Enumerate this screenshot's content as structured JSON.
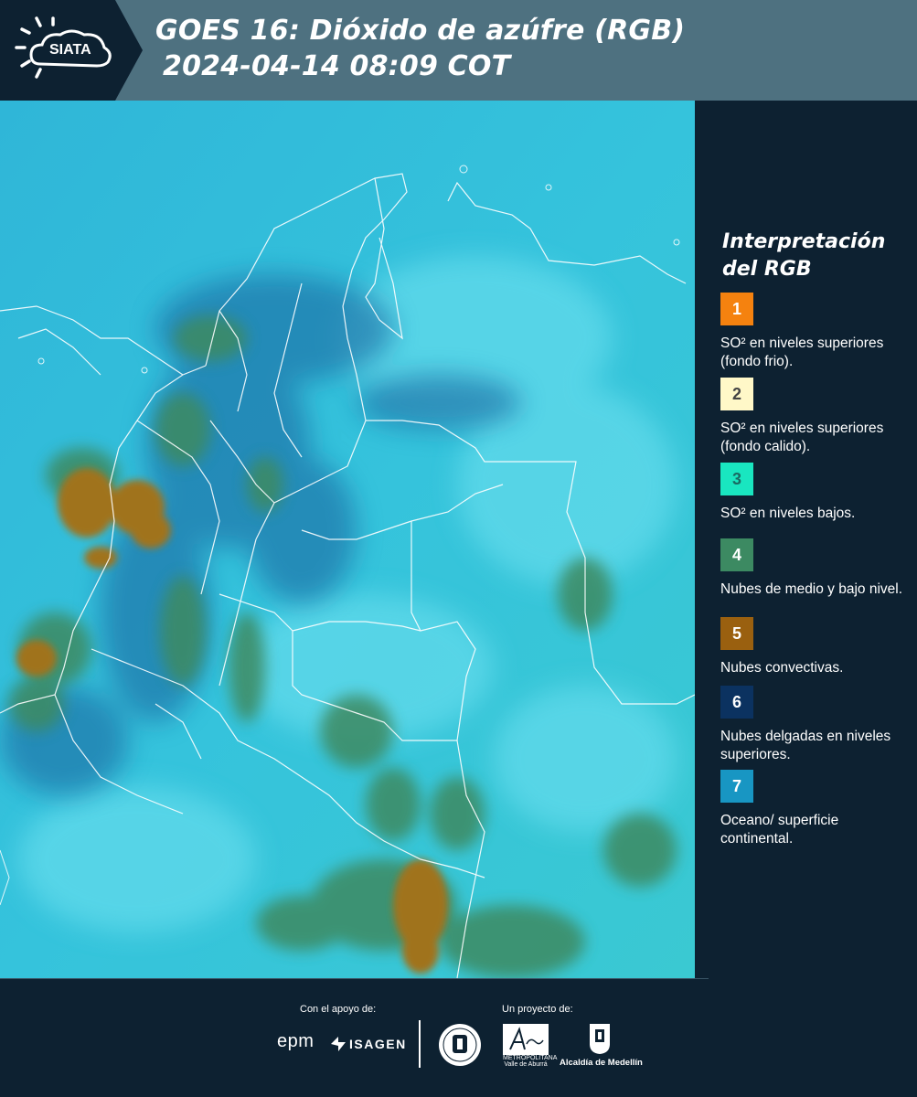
{
  "header": {
    "logo_text": "SIATA",
    "title_line1": "GOES 16: Dióxido de azúfre (RGB)",
    "title_line2": "2024-04-14 08:09 COT"
  },
  "legend": {
    "title": "Interpretación del RGB",
    "items": [
      {
        "number": "1",
        "color": "#f5820f",
        "text_color": "#ffffff",
        "label": "SO² en niveles superiores (fondo frio)."
      },
      {
        "number": "2",
        "color": "#fff8c8",
        "text_color": "#444444",
        "label": "SO² en niveles superiores (fondo calido)."
      },
      {
        "number": "3",
        "color": "#19e6c0",
        "text_color": "#1a6a62",
        "label": "SO² en niveles bajos."
      },
      {
        "number": "4",
        "color": "#3c8a62",
        "text_color": "#ffffff",
        "label": "Nubes de medio y bajo nivel."
      },
      {
        "number": "5",
        "color": "#9a600f",
        "text_color": "#ffffff",
        "label": "Nubes convectivas."
      },
      {
        "number": "6",
        "color": "#0b3260",
        "text_color": "#ffffff",
        "label": "Nubes delgadas en niveles superiores."
      },
      {
        "number": "7",
        "color": "#1896c3",
        "text_color": "#ffffff",
        "label": "Oceano/ superficie continental."
      }
    ]
  },
  "footer": {
    "support_label": "Con el apoyo de:",
    "project_label": "Un proyecto de:",
    "epm": "epm",
    "isagen": "ISAGEN",
    "area_text": "METROPOLITANA Valle de Aburrá",
    "alcaldia": "Alcaldía de Medellín"
  },
  "colors": {
    "header_bg": "#4e7180",
    "panel_bg": "#0d2131",
    "map_base": "#2ab2d3"
  }
}
